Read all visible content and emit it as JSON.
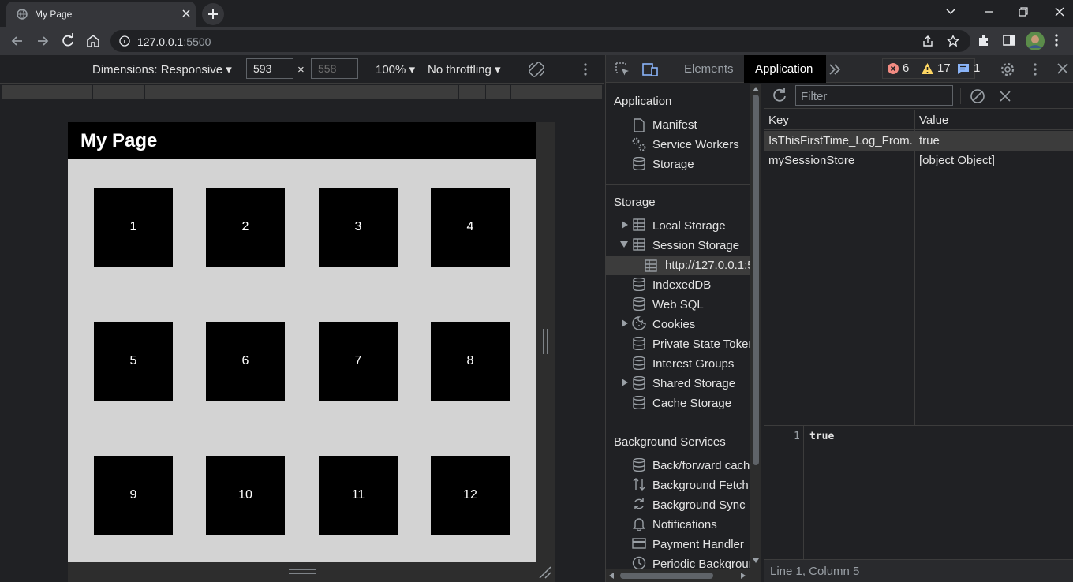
{
  "tab": {
    "title": "My Page"
  },
  "address": {
    "host": "127.0.0.1",
    "port": ":5500"
  },
  "device_toolbar": {
    "dimensions": "Dimensions: Responsive",
    "width": "593",
    "height": "558",
    "times": "×",
    "zoom": "100%",
    "throttling": "No throttling"
  },
  "page": {
    "header": "My Page",
    "boxes": [
      "1",
      "2",
      "3",
      "4",
      "5",
      "6",
      "7",
      "8",
      "9",
      "10",
      "11",
      "12"
    ]
  },
  "devtools": {
    "tabs": {
      "elements": "Elements",
      "application": "Application"
    },
    "counts": {
      "errors": "6",
      "warnings": "17",
      "messages": "1"
    },
    "sidebar": {
      "application_header": "Application",
      "application_items": [
        "Manifest",
        "Service Workers",
        "Storage"
      ],
      "storage_header": "Storage",
      "storage_items": [
        "Local Storage",
        "Session Storage",
        "http://127.0.0.1:5",
        "IndexedDB",
        "Web SQL",
        "Cookies",
        "Private State Tokens",
        "Interest Groups",
        "Shared Storage",
        "Cache Storage"
      ],
      "background_header": "Background Services",
      "background_items": [
        "Back/forward cache",
        "Background Fetch",
        "Background Sync",
        "Notifications",
        "Payment Handler",
        "Periodic Background Sync"
      ]
    },
    "filter_placeholder": "Filter",
    "table": {
      "headers": [
        "Key",
        "Value"
      ],
      "rows": [
        {
          "key": "IsThisFirstTime_Log_From...",
          "value": "true"
        },
        {
          "key": "mySessionStore",
          "value": "[object Object]"
        }
      ]
    },
    "editor": {
      "line_number": "1",
      "content": "true"
    },
    "status": "Line 1, Column 5"
  }
}
